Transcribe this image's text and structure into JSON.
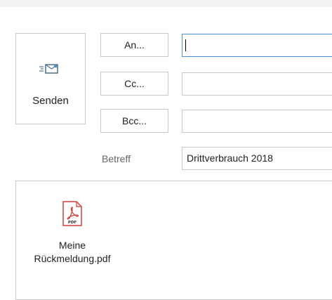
{
  "compose": {
    "send_label": "Senden",
    "to_button": "An...",
    "cc_button": "Cc...",
    "bcc_button": "Bcc...",
    "subject_label": "Betreff",
    "to_value": "",
    "cc_value": "",
    "bcc_value": "",
    "subject_value": "Drittverbrauch 2018"
  },
  "attachment": {
    "name_line1": "Meine",
    "name_line2": "Rückmeldung.pdf",
    "icon": "pdf-file-icon"
  },
  "colors": {
    "accent_border": "#4a90d9",
    "pdf_red": "#d83b3b"
  }
}
